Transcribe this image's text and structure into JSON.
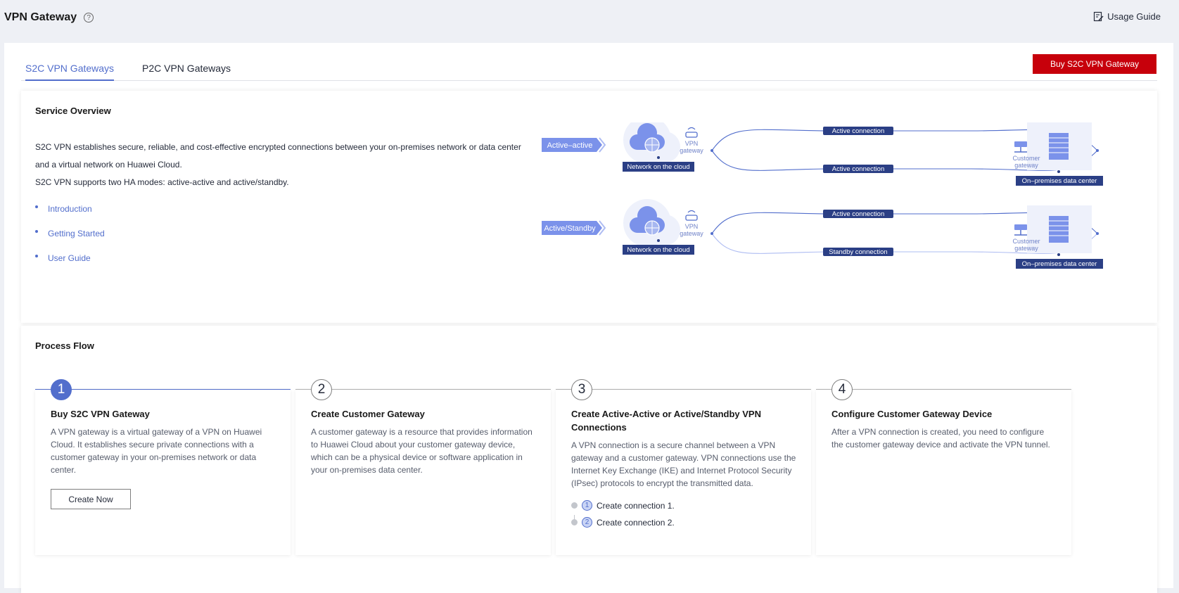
{
  "header": {
    "title": "VPN Gateway",
    "help_icon": "help-circle-icon",
    "usage_guide": "Usage Guide"
  },
  "tabs": [
    {
      "label": "S2C VPN Gateways",
      "active": true
    },
    {
      "label": "P2C VPN Gateways",
      "active": false
    }
  ],
  "buy_button": "Buy S2C VPN Gateway",
  "overview": {
    "title": "Service Overview",
    "text_line1": "S2C VPN establishes secure, reliable, and cost-effective encrypted connections between your on-premises network or data center",
    "text_line2": "and a virtual network on Huawei Cloud.",
    "text_line3": "S2C VPN supports two HA modes: active-active and active/standby.",
    "links": [
      "Introduction",
      "Getting Started",
      "User Guide"
    ]
  },
  "diagram": {
    "rows": [
      {
        "mode": "Active–active",
        "top_conn": "Active connection",
        "bottom_conn": "Active connection"
      },
      {
        "mode": "Active/Standby",
        "top_conn": "Active connection",
        "bottom_conn": "Standby connection"
      }
    ],
    "vpn_line1": "VPN",
    "vpn_line2": "gateway",
    "cg_line1": "Customer",
    "cg_line2": "gateway",
    "cloud_label": "Network on the cloud",
    "dc_label": "On–premises data center",
    "accent": "#526ecc",
    "dark_label_bg": "#2b3f85"
  },
  "process": {
    "title": "Process Flow",
    "steps": [
      {
        "num": "1",
        "title": "Buy S2C VPN Gateway",
        "desc": "A VPN gateway is a virtual gateway of a VPN on Huawei Cloud. It establishes secure private connections with a customer gateway in your on-premises network or data center.",
        "button": "Create Now"
      },
      {
        "num": "2",
        "title": "Create Customer Gateway",
        "desc": "A customer gateway is a resource that provides information to Huawei Cloud about your customer gateway device, which can be a physical device or software application in your on-premises data center."
      },
      {
        "num": "3",
        "title": "Create Active-Active or Active/Standby VPN Connections",
        "desc": "A VPN connection is a secure channel between a VPN gateway and a customer gateway. VPN connections use the Internet Key Exchange (IKE) and Internet Protocol Security (IPsec) protocols to encrypt the transmitted data.",
        "sub_steps": [
          {
            "n": "1",
            "label": "Create connection 1."
          },
          {
            "n": "2",
            "label": "Create connection 2."
          }
        ]
      },
      {
        "num": "4",
        "title": "Configure Customer Gateway Device",
        "desc": "After a VPN connection is created, you need to configure the customer gateway device and activate the VPN tunnel."
      }
    ]
  },
  "colors": {
    "brand_red": "#c7000b",
    "link_blue": "#526ecc"
  }
}
